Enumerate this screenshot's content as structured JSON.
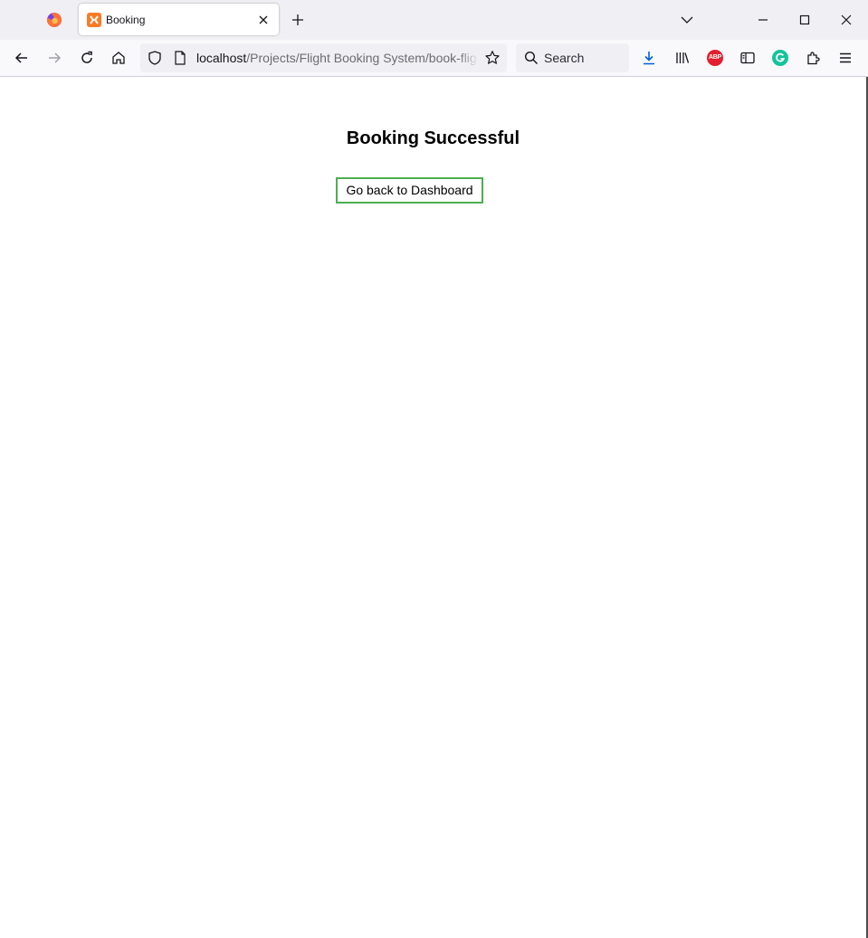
{
  "browser": {
    "tab": {
      "title": "Booking"
    },
    "url": {
      "host": "localhost",
      "path": "/Projects/Flight Booking System/book-flig"
    },
    "search": {
      "placeholder": "Search"
    },
    "extensions": {
      "adblock_label": "ABP"
    }
  },
  "page": {
    "heading": "Booking Successful",
    "back_button_label": "Go back to Dashboard",
    "accent_color": "#4caf50"
  },
  "icons": [
    "firefox-logo-icon",
    "xampp-favicon-icon",
    "close-icon",
    "plus-icon",
    "chevron-down-icon",
    "minimize-icon",
    "maximize-icon",
    "window-close-icon",
    "back-arrow-icon",
    "forward-arrow-icon",
    "reload-icon",
    "home-icon",
    "shield-icon",
    "page-icon",
    "star-icon",
    "search-icon",
    "download-icon",
    "library-icon",
    "adblock-icon",
    "sidebar-icon",
    "grammarly-icon",
    "extensions-icon",
    "menu-icon"
  ]
}
